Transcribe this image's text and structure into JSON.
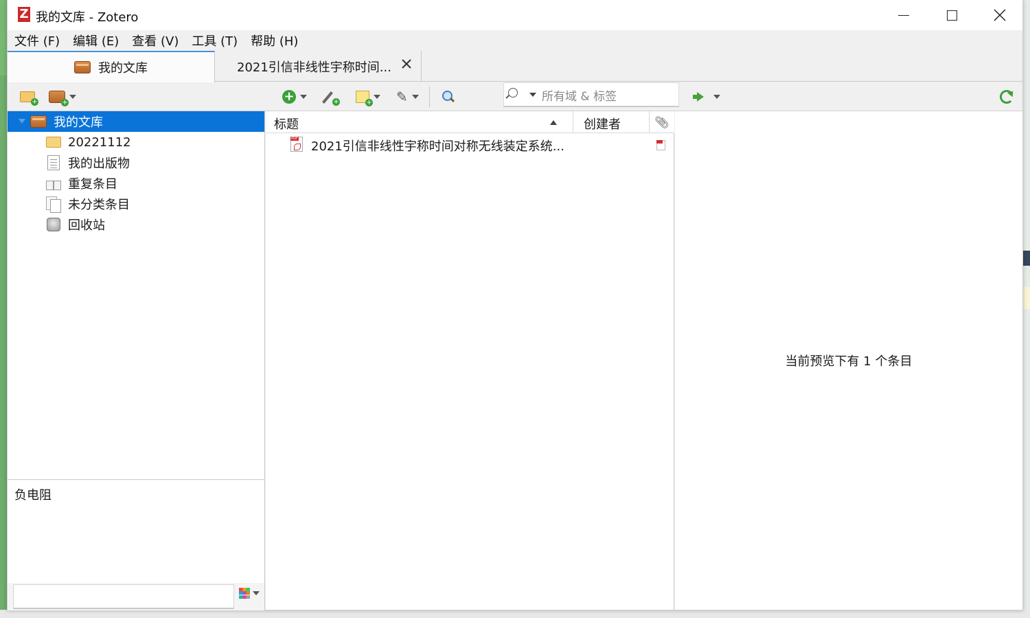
{
  "window": {
    "title": "我的文库 - Zotero",
    "app_icon_letter": "Z"
  },
  "menu": {
    "items": [
      "文件 (F)",
      "编辑 (E)",
      "查看 (V)",
      "工具 (T)",
      "帮助 (H)"
    ]
  },
  "tabs": [
    {
      "label": "我的文库",
      "active": true
    },
    {
      "label": "2021引信非线性宇称时间...",
      "active": false
    }
  ],
  "toolbar": {
    "search_placeholder": "所有域 & 标签"
  },
  "collections": {
    "items": [
      {
        "label": "我的文库",
        "icon": "library-icon",
        "selected": true
      },
      {
        "label": "20221112",
        "icon": "folder-icon"
      },
      {
        "label": "我的出版物",
        "icon": "publications-icon"
      },
      {
        "label": "重复条目",
        "icon": "duplicates-icon"
      },
      {
        "label": "未分类条目",
        "icon": "unfiled-icon"
      },
      {
        "label": "回收站",
        "icon": "trash-icon"
      }
    ]
  },
  "tags": {
    "items": [
      "负电阻"
    ],
    "filter_value": ""
  },
  "items_pane": {
    "columns": {
      "title": "标题",
      "creator": "创建者"
    },
    "rows": [
      {
        "title": "2021引信非线性宇称时间对称无线装定系统...",
        "creator": "",
        "has_pdf": true
      }
    ]
  },
  "item_pane": {
    "message": "当前预览下有 1 个条目"
  },
  "colors": {
    "selection": "#0a74d9",
    "accent_tab": "#4a90d9",
    "brand": "#cc2929"
  }
}
